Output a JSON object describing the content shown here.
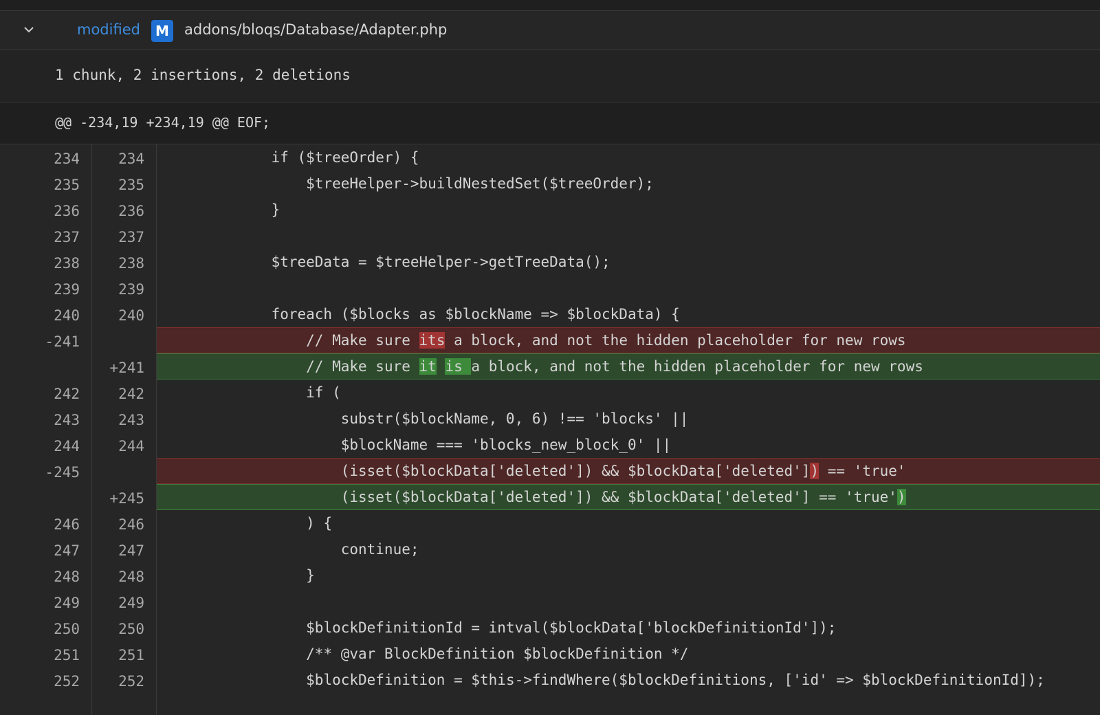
{
  "file": {
    "status": "modified",
    "badge": "M",
    "path": "addons/bloqs/Database/Adapter.php"
  },
  "summary": "1 chunk, 2 insertions, 2 deletions",
  "hunk_header": "@@ -234,19 +234,19 @@ EOF;",
  "colors": {
    "deleted_bg": "#4e2625",
    "deleted_highlight": "#a23433",
    "inserted_bg": "#2d4b2c",
    "inserted_highlight": "#3c8a3a",
    "status_blue": "#3d8de0"
  },
  "lines": [
    {
      "type": "ctx",
      "old": "234",
      "new": "234",
      "indent": "    ",
      "text": "if ($treeOrder) {"
    },
    {
      "type": "ctx",
      "old": "235",
      "new": "235",
      "indent": "        ",
      "text": "$treeHelper->buildNestedSet($treeOrder);"
    },
    {
      "type": "ctx",
      "old": "236",
      "new": "236",
      "indent": "    ",
      "text": "}"
    },
    {
      "type": "ctx",
      "old": "237",
      "new": "237",
      "indent": "",
      "text": ""
    },
    {
      "type": "ctx",
      "old": "238",
      "new": "238",
      "indent": "    ",
      "text": "$treeData = $treeHelper->getTreeData();"
    },
    {
      "type": "ctx",
      "old": "239",
      "new": "239",
      "indent": "",
      "text": ""
    },
    {
      "type": "ctx",
      "old": "240",
      "new": "240",
      "indent": "    ",
      "text": "foreach ($blocks as $blockName => $blockData) {"
    },
    {
      "type": "del",
      "old": "-241",
      "new": "",
      "indent": "        ",
      "segments": [
        {
          "t": "// Make sure ",
          "h": false
        },
        {
          "t": "its",
          "h": true
        },
        {
          "t": " a block, and not the hidden placeholder for new rows",
          "h": false
        }
      ]
    },
    {
      "type": "ins",
      "old": "",
      "new": "+241",
      "indent": "        ",
      "segments": [
        {
          "t": "// Make sure ",
          "h": false
        },
        {
          "t": "it",
          "h": true
        },
        {
          "t": " ",
          "h": false
        },
        {
          "t": "is ",
          "h": true
        },
        {
          "t": "a block, and not the hidden placeholder for new rows",
          "h": false
        }
      ]
    },
    {
      "type": "ctx",
      "old": "242",
      "new": "242",
      "indent": "        ",
      "text": "if ("
    },
    {
      "type": "ctx",
      "old": "243",
      "new": "243",
      "indent": "            ",
      "text": "substr($blockName, 0, 6) !== 'blocks' ||"
    },
    {
      "type": "ctx",
      "old": "244",
      "new": "244",
      "indent": "            ",
      "text": "$blockName === 'blocks_new_block_0' ||"
    },
    {
      "type": "del",
      "old": "-245",
      "new": "",
      "indent": "            ",
      "segments": [
        {
          "t": "(isset($blockData['deleted']) && $blockData['deleted']",
          "h": false
        },
        {
          "t": ")",
          "h": true
        },
        {
          "t": " == 'true'",
          "h": false
        }
      ]
    },
    {
      "type": "ins",
      "old": "",
      "new": "+245",
      "indent": "            ",
      "segments": [
        {
          "t": "(isset($blockData['deleted']) && $blockData['deleted'] == 'true'",
          "h": false
        },
        {
          "t": ")",
          "h": true
        }
      ]
    },
    {
      "type": "ctx",
      "old": "246",
      "new": "246",
      "indent": "        ",
      "text": ") {"
    },
    {
      "type": "ctx",
      "old": "247",
      "new": "247",
      "indent": "            ",
      "text": "continue;"
    },
    {
      "type": "ctx",
      "old": "248",
      "new": "248",
      "indent": "        ",
      "text": "}"
    },
    {
      "type": "ctx",
      "old": "249",
      "new": "249",
      "indent": "",
      "text": ""
    },
    {
      "type": "ctx",
      "old": "250",
      "new": "250",
      "indent": "        ",
      "text": "$blockDefinitionId = intval($blockData['blockDefinitionId']);"
    },
    {
      "type": "ctx",
      "old": "251",
      "new": "251",
      "indent": "        ",
      "text": "/** @var BlockDefinition $blockDefinition */"
    },
    {
      "type": "ctx",
      "old": "252",
      "new": "252",
      "indent": "        ",
      "text": "$blockDefinition = $this->findWhere($blockDefinitions, ['id' => $blockDefinitionId]);"
    }
  ]
}
